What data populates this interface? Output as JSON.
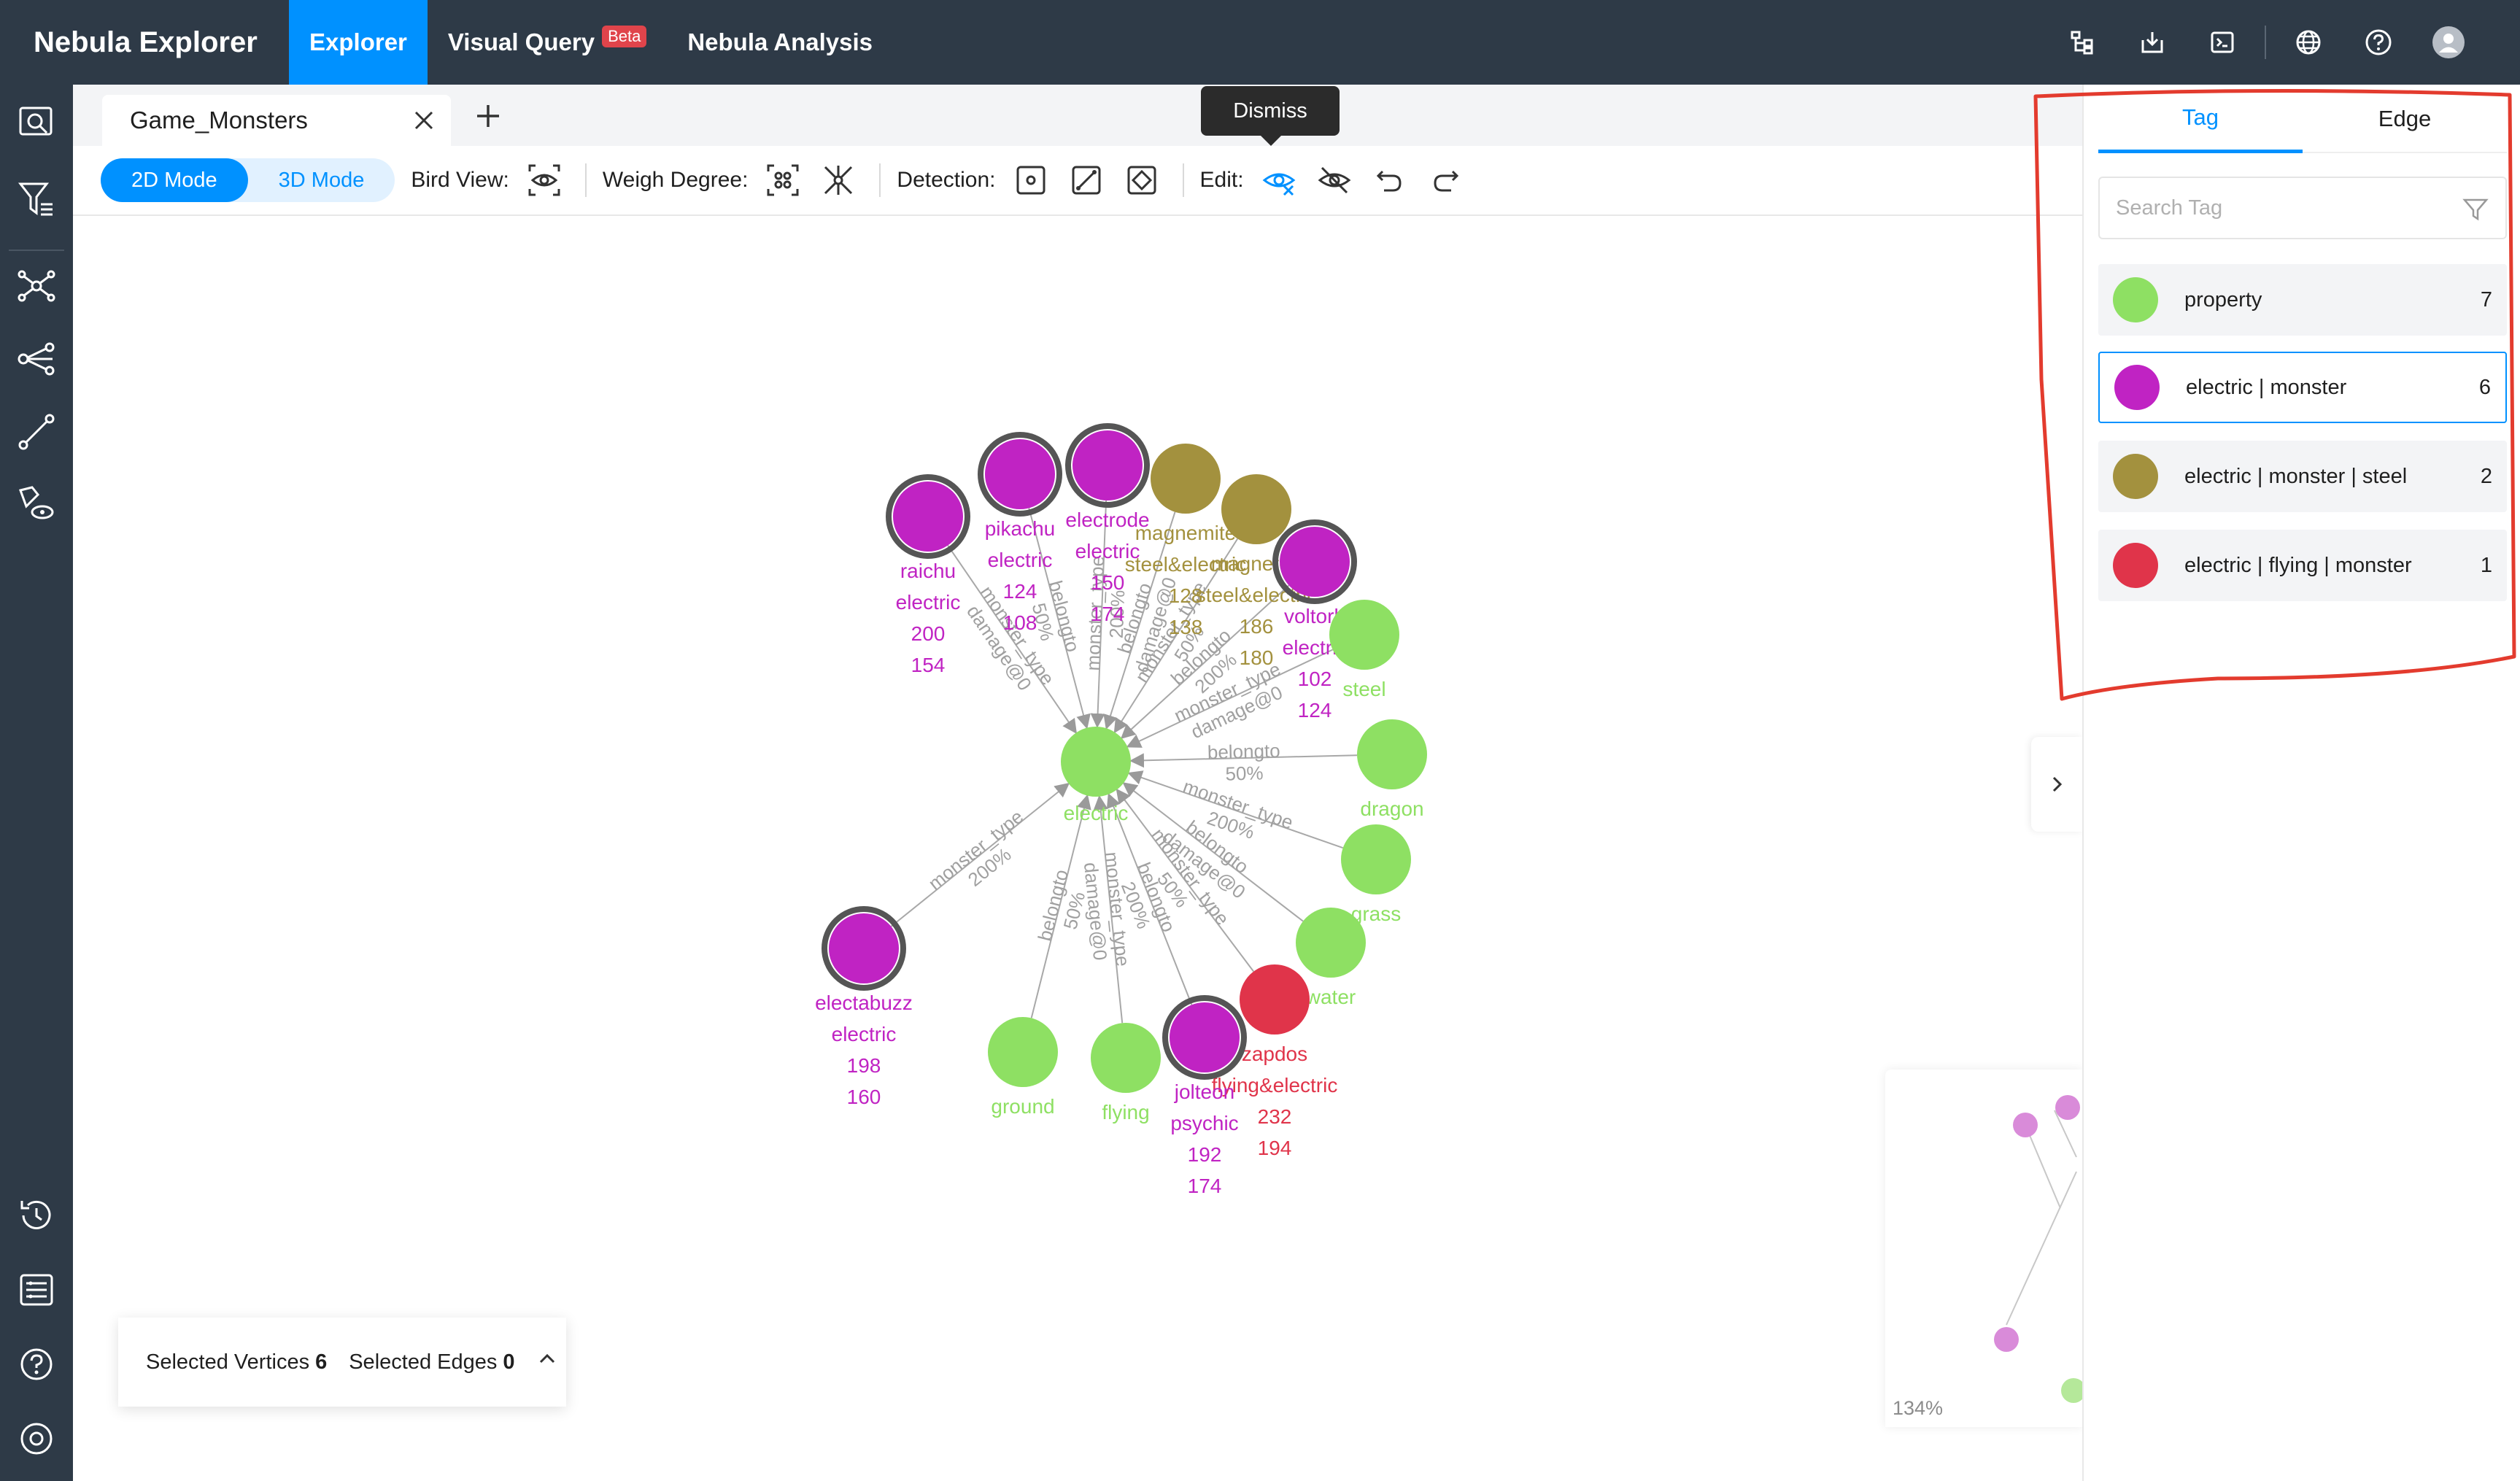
{
  "app": {
    "title": "Nebula Explorer",
    "nav": [
      {
        "label": "Explorer",
        "active": true
      },
      {
        "label": "Visual Query",
        "badge": "Beta"
      },
      {
        "label": "Nebula Analysis"
      }
    ],
    "top_icons": [
      "schema-icon",
      "download-icon",
      "console-icon",
      "globe-icon",
      "help-icon",
      "avatar-icon"
    ]
  },
  "sidebar": {
    "icons": [
      "search-icon",
      "filter-icon",
      "expand-icon",
      "common-neighbor-icon",
      "path-icon",
      "property-view-icon",
      "history-icon",
      "snapshot-icon",
      "help-icon",
      "settings-icon"
    ]
  },
  "tabs": {
    "current": "Game_Monsters",
    "add_label": "+"
  },
  "toolbar": {
    "mode_2d": "2D Mode",
    "mode_3d": "3D Mode",
    "bird_view": "Bird View:",
    "weigh_degree": "Weigh Degree:",
    "detection": "Detection:",
    "edit": "Edit:",
    "tooltip": "Dismiss"
  },
  "graph": {
    "hub": {
      "label": "electric",
      "color": "#8ee063"
    },
    "vertices": [
      {
        "name": "raichu",
        "lines": [
          "raichu",
          "electric",
          "200",
          "154"
        ],
        "color": "#c023c3",
        "selected": true
      },
      {
        "name": "pikachu",
        "lines": [
          "pikachu",
          "electric",
          "124",
          "108"
        ],
        "color": "#c023c3",
        "selected": true
      },
      {
        "name": "electrode",
        "lines": [
          "electrode",
          "electric",
          "150",
          "174"
        ],
        "color": "#c023c3",
        "selected": true
      },
      {
        "name": "magnemite",
        "lines": [
          "magnemite",
          "steel&electric",
          "128",
          "138"
        ],
        "color": "#a3913e",
        "selected": false
      },
      {
        "name": "magneton",
        "lines": [
          "magneton",
          "steel&electric",
          "186",
          "180"
        ],
        "color": "#a3913e",
        "selected": false
      },
      {
        "name": "voltorb",
        "lines": [
          "voltorb",
          "electric",
          "102",
          "124"
        ],
        "color": "#c023c3",
        "selected": true
      },
      {
        "name": "steel",
        "lines": [
          "steel"
        ],
        "color": "#8ee063",
        "selected": false
      },
      {
        "name": "dragon",
        "lines": [
          "dragon"
        ],
        "color": "#8ee063",
        "selected": false
      },
      {
        "name": "grass",
        "lines": [
          "grass"
        ],
        "color": "#8ee063",
        "selected": false
      },
      {
        "name": "water",
        "lines": [
          "water"
        ],
        "color": "#8ee063",
        "selected": false
      },
      {
        "name": "zapdos",
        "lines": [
          "zapdos",
          "flying&electric",
          "232",
          "194"
        ],
        "color": "#e0344a",
        "selected": false
      },
      {
        "name": "jolteon",
        "lines": [
          "jolteon",
          "psychic",
          "192",
          "174"
        ],
        "color": "#c023c3",
        "selected": true
      },
      {
        "name": "flying",
        "lines": [
          "flying"
        ],
        "color": "#8ee063",
        "selected": false
      },
      {
        "name": "ground",
        "lines": [
          "ground"
        ],
        "color": "#8ee063",
        "selected": false
      },
      {
        "name": "electabuzz",
        "lines": [
          "electabuzz",
          "electric",
          "198",
          "160"
        ],
        "color": "#c023c3",
        "selected": true
      }
    ],
    "edge_labels": [
      "monster_type",
      "belongto",
      "damage@0",
      "50%",
      "200%"
    ]
  },
  "selection": {
    "vertices_label": "Selected Vertices",
    "vertices_count": "6",
    "edges_label": "Selected Edges",
    "edges_count": "0"
  },
  "minimap": {
    "zoom": "134%"
  },
  "right_panel": {
    "tabs": [
      {
        "label": "Tag",
        "active": true
      },
      {
        "label": "Edge",
        "active": false
      }
    ],
    "search_placeholder": "Search Tag",
    "tags": [
      {
        "label": "property",
        "count": "7",
        "color": "#8ee063",
        "selected": false
      },
      {
        "label": "electric | monster",
        "count": "6",
        "color": "#c023c3",
        "selected": true
      },
      {
        "label": "electric | monster | steel",
        "count": "2",
        "color": "#a3913e",
        "selected": false
      },
      {
        "label": "electric | flying | monster",
        "count": "1",
        "color": "#e0344a",
        "selected": false
      }
    ]
  },
  "colors": {
    "brand_dark": "#2e3a47",
    "accent": "#0091ff",
    "annotation": "#e33b2e"
  }
}
